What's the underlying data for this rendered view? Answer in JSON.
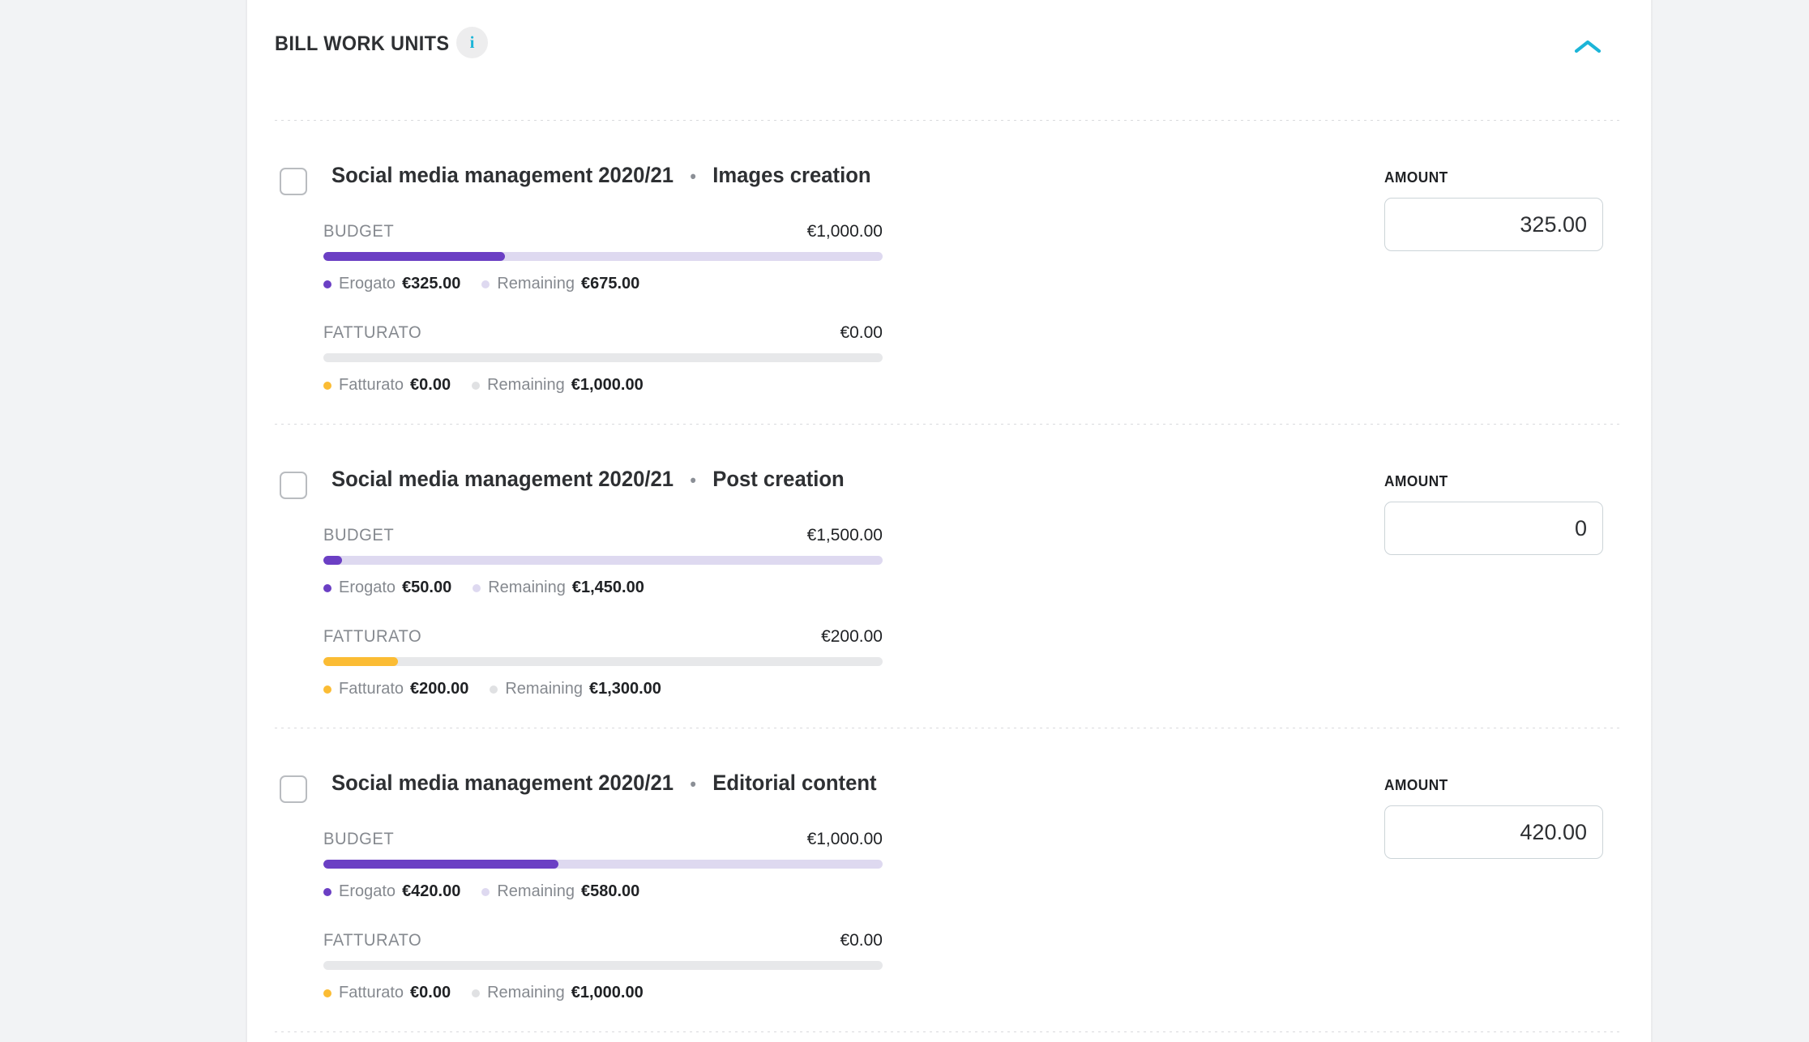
{
  "header": {
    "title": "BILL WORK UNITS",
    "info_icon": "info-icon",
    "info_glyph": "i",
    "collapse_icon": "chevron-up-icon"
  },
  "colors": {
    "budget_fill": "#6b3fc4",
    "budget_track": "#ded9f0",
    "fatturato_fill": "#fbbc34",
    "fatturato_track": "#e7e8ea",
    "accent": "#1cb5d8",
    "page_bg": "#f2f3f5",
    "card_bg": "#ffffff"
  },
  "labels": {
    "budget": "BUDGET",
    "fatturato": "FATTURATO",
    "amount": "AMOUNT",
    "erogato": "Erogato",
    "remaining": "Remaining",
    "fatturato_legend": "Fatturato",
    "separator": "•"
  },
  "units": [
    {
      "project": "Social media management 2020/21",
      "task": "Images creation",
      "checked": false,
      "budget": {
        "label": "BUDGET",
        "total": "€1,000.00",
        "total_value": 1000,
        "spent_label": "Erogato",
        "spent": "€325.00",
        "spent_value": 325,
        "remaining_label": "Remaining",
        "remaining": "€675.00",
        "remaining_value": 675,
        "percent": 32.5
      },
      "fatturato": {
        "label": "FATTURATO",
        "total": "€0.00",
        "total_value": 0,
        "spent_label": "Fatturato",
        "spent": "€0.00",
        "spent_value": 0,
        "remaining_label": "Remaining",
        "remaining": "€1,000.00",
        "remaining_value": 1000,
        "percent": 0
      },
      "amount_label": "AMOUNT",
      "amount_value": "325.00"
    },
    {
      "project": "Social media management 2020/21",
      "task": "Post creation",
      "checked": false,
      "budget": {
        "label": "BUDGET",
        "total": "€1,500.00",
        "total_value": 1500,
        "spent_label": "Erogato",
        "spent": "€50.00",
        "spent_value": 50,
        "remaining_label": "Remaining",
        "remaining": "€1,450.00",
        "remaining_value": 1450,
        "percent": 3.3
      },
      "fatturato": {
        "label": "FATTURATO",
        "total": "€200.00",
        "total_value": 200,
        "spent_label": "Fatturato",
        "spent": "€200.00",
        "spent_value": 200,
        "remaining_label": "Remaining",
        "remaining": "€1,300.00",
        "remaining_value": 1300,
        "percent": 13.3
      },
      "amount_label": "AMOUNT",
      "amount_value": "0"
    },
    {
      "project": "Social media management 2020/21",
      "task": "Editorial content",
      "checked": false,
      "budget": {
        "label": "BUDGET",
        "total": "€1,000.00",
        "total_value": 1000,
        "spent_label": "Erogato",
        "spent": "€420.00",
        "spent_value": 420,
        "remaining_label": "Remaining",
        "remaining": "€580.00",
        "remaining_value": 580,
        "percent": 42
      },
      "fatturato": {
        "label": "FATTURATO",
        "total": "€0.00",
        "total_value": 0,
        "spent_label": "Fatturato",
        "spent": "€0.00",
        "spent_value": 0,
        "remaining_label": "Remaining",
        "remaining": "€1,000.00",
        "remaining_value": 1000,
        "percent": 0
      },
      "amount_label": "AMOUNT",
      "amount_value": "420.00"
    }
  ]
}
